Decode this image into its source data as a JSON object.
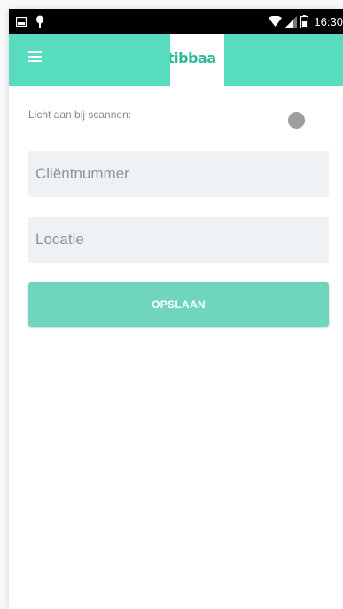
{
  "status_bar": {
    "time": "16:30",
    "icons": [
      "image-notification-icon",
      "bug-notification-icon",
      "wifi-icon",
      "signal-icon",
      "battery-icon"
    ]
  },
  "app_bar": {
    "menu_icon": "hamburger-menu-icon",
    "logo_text": "tibbaa",
    "background_color": "#58dcc0"
  },
  "settings": {
    "light_on_scan_label": "Licht aan bij scannen:",
    "light_on_scan_enabled": false
  },
  "form": {
    "client_number_placeholder": "Cliëntnummer",
    "location_placeholder": "Locatie",
    "save_label": "OPSLAAN",
    "button_color": "#6fd5bd"
  }
}
